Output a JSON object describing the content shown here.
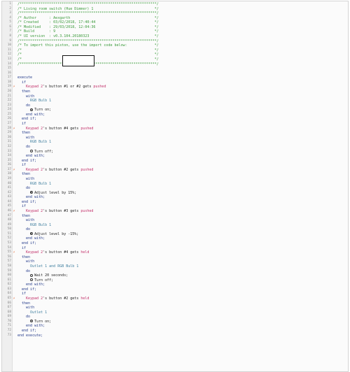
{
  "header_comment": [
    "/*****************************************************************/",
    "/* Living room switch (Hue Dimmer) 1                             */",
    "/*****************************************************************/",
    "/* Author      : Aexgarth                                        */",
    "/* Created     : 03/02/2018, 17:40:44                            */",
    "/* Modified    : 29/03/2018, 12:04:36                            */",
    "/* Build       : 9                                               */",
    "/* UI version  : v0.3.104.20180323                               */",
    "/*****************************************************************/",
    "/* To import this piston, use the import code below:             */",
    "/*                                                               */",
    "/*                                                               */",
    "/*                                                               */",
    "/*****************************************************************/"
  ],
  "lines": [
    {
      "n": "1",
      "t": "cmt",
      "s": "/*****************************************************************/"
    },
    {
      "n": "2",
      "t": "cmt",
      "s": "/* Living room switch (Hue Dimmer) 1                             */"
    },
    {
      "n": "3",
      "t": "cmt",
      "s": "/*****************************************************************/"
    },
    {
      "n": "4",
      "t": "cmt",
      "s": "/* Author      : Aexgarth                                        */"
    },
    {
      "n": "5",
      "t": "cmt",
      "s": "/* Created     : 03/02/2018, 17:40:44                            */"
    },
    {
      "n": "6",
      "t": "cmt",
      "s": "/* Modified    : 29/03/2018, 12:04:36                            */"
    },
    {
      "n": "7",
      "t": "cmt",
      "s": "/* Build       : 9                                               */"
    },
    {
      "n": "8",
      "t": "cmt",
      "s": "/* UI version  : v0.3.104.20180323                               */"
    },
    {
      "n": "9",
      "t": "cmt",
      "s": "/*****************************************************************/"
    },
    {
      "n": "10",
      "t": "cmt",
      "s": "/* To import this piston, use the import code below:             */"
    },
    {
      "n": "11",
      "t": "cmt",
      "s": "/*                                                               */"
    },
    {
      "n": "12",
      "t": "cmt",
      "s": "/*                                                               */"
    },
    {
      "n": "13",
      "t": "cmt",
      "s": "/*                                                               */"
    },
    {
      "n": "14",
      "t": "cmt",
      "s": "/*****************************************************************/"
    },
    {
      "n": "15",
      "t": "blank",
      "s": ""
    },
    {
      "n": "16",
      "t": "blank",
      "s": ""
    },
    {
      "n": "17",
      "t": "kw",
      "s": "execute"
    },
    {
      "n": "18",
      "t": "kw",
      "s": "  if"
    },
    {
      "n": "19",
      "t": "trig",
      "s": "    ",
      "d": "Keypad 2",
      "r": "'s button #1 or #2 gets ",
      "a": "pushed",
      "mark": "⚡"
    },
    {
      "n": "20",
      "t": "kw",
      "s": "  then"
    },
    {
      "n": "21",
      "t": "kw",
      "s": "    with"
    },
    {
      "n": "22",
      "t": "obj",
      "s": "      RGB Bulb 1"
    },
    {
      "n": "23",
      "t": "kw",
      "s": "    do"
    },
    {
      "n": "24",
      "t": "cmd",
      "s": "      ",
      "icon": "dot",
      "c": "Turn on;"
    },
    {
      "n": "25",
      "t": "kw",
      "s": "    end with;"
    },
    {
      "n": "26",
      "t": "kw",
      "s": "  end if;"
    },
    {
      "n": "27",
      "t": "kw",
      "s": "  if"
    },
    {
      "n": "28",
      "t": "trig",
      "s": "    ",
      "d": "Keypad 2",
      "r": "'s button #4 gets ",
      "a": "pushed",
      "mark": "⚡"
    },
    {
      "n": "29",
      "t": "kw",
      "s": "  then"
    },
    {
      "n": "30",
      "t": "kw",
      "s": "    with"
    },
    {
      "n": "31",
      "t": "obj",
      "s": "      RGB Bulb 1"
    },
    {
      "n": "32",
      "t": "kw",
      "s": "    do"
    },
    {
      "n": "33",
      "t": "cmd",
      "s": "      ",
      "icon": "ring",
      "c": "Turn off;"
    },
    {
      "n": "34",
      "t": "kw",
      "s": "    end with;"
    },
    {
      "n": "35",
      "t": "kw",
      "s": "  end if;"
    },
    {
      "n": "36",
      "t": "kw",
      "s": "  if"
    },
    {
      "n": "37",
      "t": "trig",
      "s": "    ",
      "d": "Keypad 2",
      "r": "'s button #2 gets ",
      "a": "pushed",
      "mark": "⚡"
    },
    {
      "n": "38",
      "t": "kw",
      "s": "  then"
    },
    {
      "n": "39",
      "t": "kw",
      "s": "    with"
    },
    {
      "n": "40",
      "t": "obj",
      "s": "      RGB Bulb 1"
    },
    {
      "n": "41",
      "t": "kw",
      "s": "    do"
    },
    {
      "n": "42",
      "t": "cmd",
      "s": "      ",
      "icon": "half",
      "c": "Adjust level by 15%;"
    },
    {
      "n": "43",
      "t": "kw",
      "s": "    end with;"
    },
    {
      "n": "44",
      "t": "kw",
      "s": "  end if;"
    },
    {
      "n": "45",
      "t": "kw",
      "s": "  if"
    },
    {
      "n": "46",
      "t": "trig",
      "s": "    ",
      "d": "Keypad 2",
      "r": "'s button #3 gets ",
      "a": "pushed",
      "mark": "⚡"
    },
    {
      "n": "47",
      "t": "kw",
      "s": "  then"
    },
    {
      "n": "48",
      "t": "kw",
      "s": "    with"
    },
    {
      "n": "49",
      "t": "obj",
      "s": "      RGB Bulb 1"
    },
    {
      "n": "50",
      "t": "kw",
      "s": "    do"
    },
    {
      "n": "51",
      "t": "cmd",
      "s": "      ",
      "icon": "half",
      "c": "Adjust level by -15%;"
    },
    {
      "n": "52",
      "t": "kw",
      "s": "    end with;"
    },
    {
      "n": "53",
      "t": "kw",
      "s": "  end if;"
    },
    {
      "n": "54",
      "t": "kw",
      "s": "  if"
    },
    {
      "n": "55",
      "t": "trig",
      "s": "    ",
      "d": "Keypad 2",
      "r": "'s button #4 gets ",
      "a": "held",
      "mark": "⚡"
    },
    {
      "n": "56",
      "t": "kw",
      "s": "  then"
    },
    {
      "n": "57",
      "t": "kw",
      "s": "    with"
    },
    {
      "n": "58",
      "t": "obj",
      "s": "      Outlet 1 and RGB Bulb 1"
    },
    {
      "n": "59",
      "t": "kw",
      "s": "    do"
    },
    {
      "n": "60",
      "t": "cmd",
      "s": "      ",
      "icon": "ring",
      "c": "Wait 20 seconds;"
    },
    {
      "n": "61",
      "t": "cmd",
      "s": "      ",
      "icon": "ring",
      "c": "Turn off;"
    },
    {
      "n": "62",
      "t": "kw",
      "s": "    end with;"
    },
    {
      "n": "63",
      "t": "kw",
      "s": "  end if;"
    },
    {
      "n": "64",
      "t": "kw",
      "s": "  if"
    },
    {
      "n": "65",
      "t": "trig",
      "s": "    ",
      "d": "Keypad 2",
      "r": "'s button #2 gets ",
      "a": "held",
      "mark": "⚡"
    },
    {
      "n": "66",
      "t": "kw",
      "s": "  then"
    },
    {
      "n": "67",
      "t": "kw",
      "s": "    with"
    },
    {
      "n": "68",
      "t": "obj",
      "s": "      Outlet 1"
    },
    {
      "n": "69",
      "t": "kw",
      "s": "    do"
    },
    {
      "n": "70",
      "t": "cmd",
      "s": "      ",
      "icon": "dot",
      "c": "Turn on;"
    },
    {
      "n": "71",
      "t": "kw",
      "s": "    end with;"
    },
    {
      "n": "72",
      "t": "kw",
      "s": "  end if;"
    },
    {
      "n": "73",
      "t": "kw",
      "s": "end execute;"
    }
  ],
  "colors": {
    "comment": "#3a9a3a",
    "keyword": "#233a8a",
    "device": "#c2306a",
    "object": "#3e7e9e",
    "trigger_mark": "#e0602a"
  }
}
